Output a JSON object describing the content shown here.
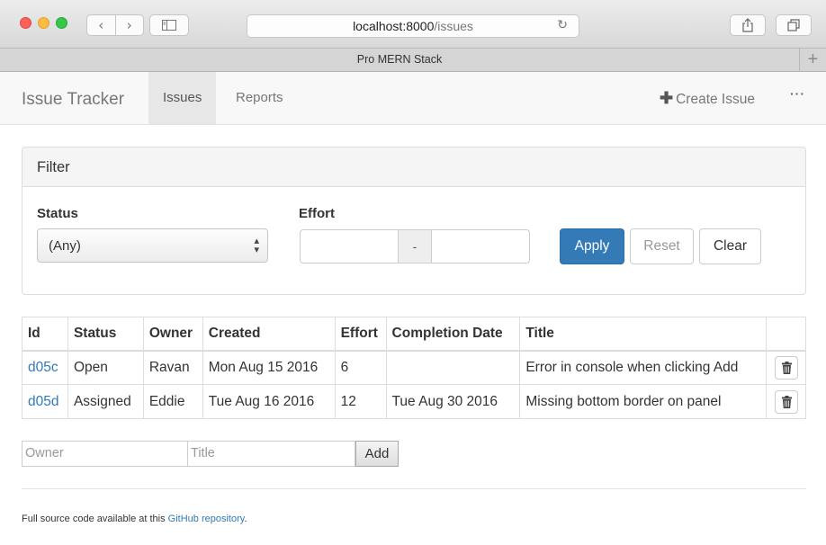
{
  "browser": {
    "url_host": "localhost:8000",
    "url_path": "/issues",
    "tab_title": "Pro MERN Stack",
    "back_glyph": "‹",
    "forward_glyph": "›",
    "reload_glyph": "↻",
    "new_tab_glyph": "+"
  },
  "navbar": {
    "brand": "Issue Tracker",
    "items": [
      {
        "label": "Issues",
        "active": true
      },
      {
        "label": "Reports",
        "active": false
      }
    ],
    "create_issue": "Create Issue",
    "create_plus": "✚",
    "more": "···"
  },
  "filter": {
    "title": "Filter",
    "status_label": "Status",
    "status_value": "(Any)",
    "effort_label": "Effort",
    "effort_min": "",
    "effort_max": "",
    "effort_separator": "-",
    "apply_label": "Apply",
    "reset_label": "Reset",
    "clear_label": "Clear"
  },
  "table": {
    "headers": [
      "Id",
      "Status",
      "Owner",
      "Created",
      "Effort",
      "Completion Date",
      "Title"
    ],
    "rows": [
      {
        "id": "d05c",
        "status": "Open",
        "owner": "Ravan",
        "created": "Mon Aug 15 2016",
        "effort": "6",
        "completion": "",
        "title": "Error in console when clicking Add"
      },
      {
        "id": "d05d",
        "status": "Assigned",
        "owner": "Eddie",
        "created": "Tue Aug 16 2016",
        "effort": "12",
        "completion": "Tue Aug 30 2016",
        "title": "Missing bottom border on panel"
      }
    ]
  },
  "add_form": {
    "owner_placeholder": "Owner",
    "title_placeholder": "Title",
    "add_label": "Add"
  },
  "footer": {
    "text_before": "Full source code available at this ",
    "link_text": "GitHub repository",
    "text_after": "."
  },
  "colors": {
    "primary": "#337ab7",
    "link": "#337ab7"
  }
}
